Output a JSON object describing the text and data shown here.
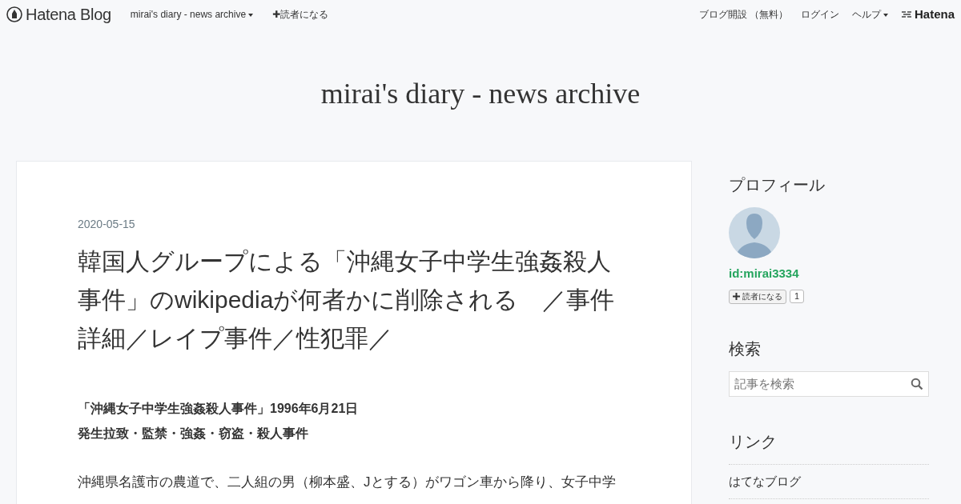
{
  "global_header": {
    "logo": "Hatena Blog",
    "blog_menu": "mirai's diary - news archive",
    "subscribe": "✚読者になる",
    "links": [
      {
        "label": "ブログ開設 （無料）",
        "dropdown": false
      },
      {
        "label": "ログイン",
        "dropdown": false
      },
      {
        "label": "ヘルプ",
        "dropdown": true
      }
    ],
    "brand": "Hatena"
  },
  "blog_title": "mirai's diary - news archive",
  "entry": {
    "date": "2020-05-15",
    "title": "韓国人グループによる「沖縄女子中学生強姦殺人事件」のwikipediaが何者かに削除される　／事件詳細／レイプ事件／性犯罪／",
    "paragraphs": [
      {
        "kind": "bold",
        "lines": [
          "「沖縄女子中学生強姦殺人事件」1996年6月21日",
          "発生拉致・監禁・強姦・窃盗・殺人事件"
        ]
      },
      {
        "kind": "plain",
        "lines": [
          "沖縄県名護市の農道で、二人組の男（柳本盛、Jとする）がワゴン車から降り、女子中学"
        ]
      }
    ]
  },
  "sidebar": {
    "profile": {
      "heading": "プロフィール",
      "user_id": "id:mirai3334",
      "subscribe": "読者になる",
      "count": "1"
    },
    "search": {
      "heading": "検索",
      "placeholder": "記事を検索"
    },
    "links": {
      "heading": "リンク",
      "items": [
        "はてなブログ"
      ]
    }
  }
}
